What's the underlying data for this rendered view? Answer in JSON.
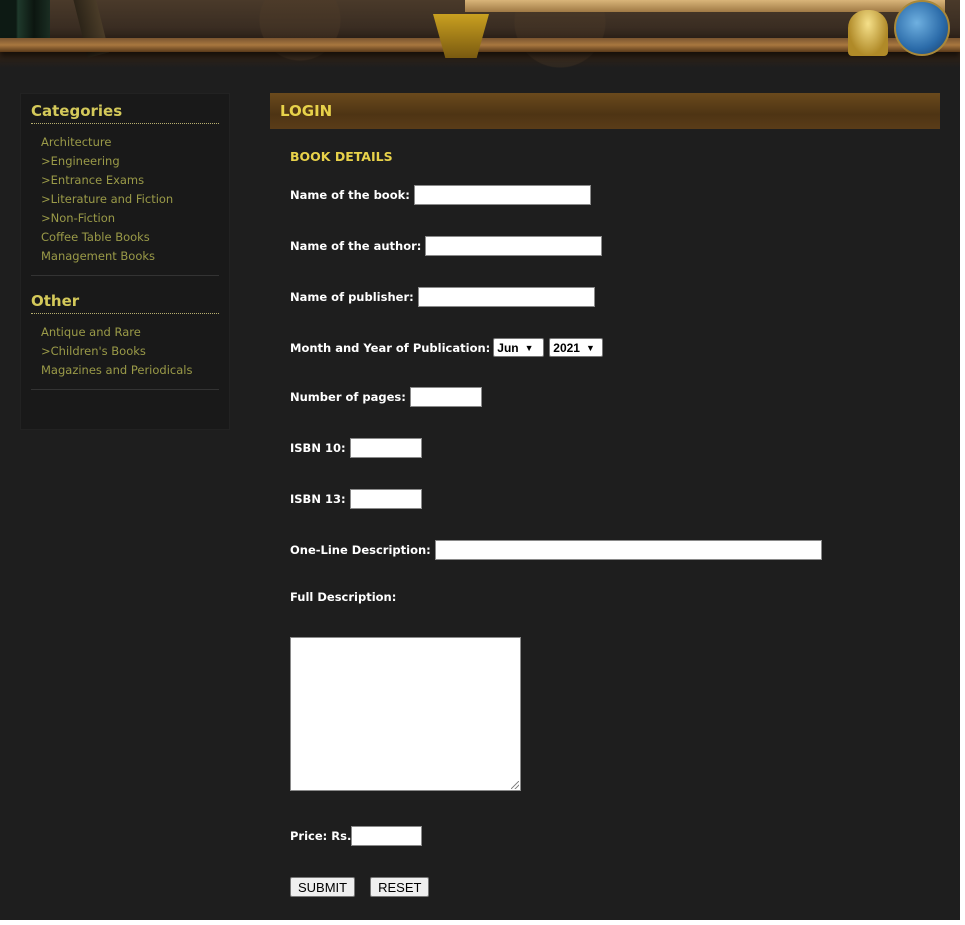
{
  "sidebar": {
    "categories_title": "Categories",
    "categories": [
      "Architecture",
      ">Engineering",
      ">Entrance Exams",
      ">Literature and Fiction",
      ">Non-Fiction",
      "Coffee Table Books",
      "Management Books"
    ],
    "other_title": "Other",
    "other": [
      "Antique and Rare",
      ">Children's Books",
      "Magazines and Periodicals"
    ]
  },
  "main": {
    "header": "LOGIN",
    "section_title": "BOOK DETAILS",
    "fields": {
      "book_name_label": "Name of the book:",
      "author_label": "Name of the author:",
      "publisher_label": "Name of publisher:",
      "pub_date_label": "Month and Year of Publication:",
      "month_value": "Jun",
      "year_value": "2021",
      "pages_label": "Number of pages:",
      "isbn10_label": "ISBN 10:",
      "isbn13_label": "ISBN 13:",
      "oneline_label": "One-Line Description:",
      "full_label": "Full Description:",
      "price_label": "Price: Rs."
    },
    "buttons": {
      "submit": "SUBMIT",
      "reset": "RESET"
    }
  }
}
